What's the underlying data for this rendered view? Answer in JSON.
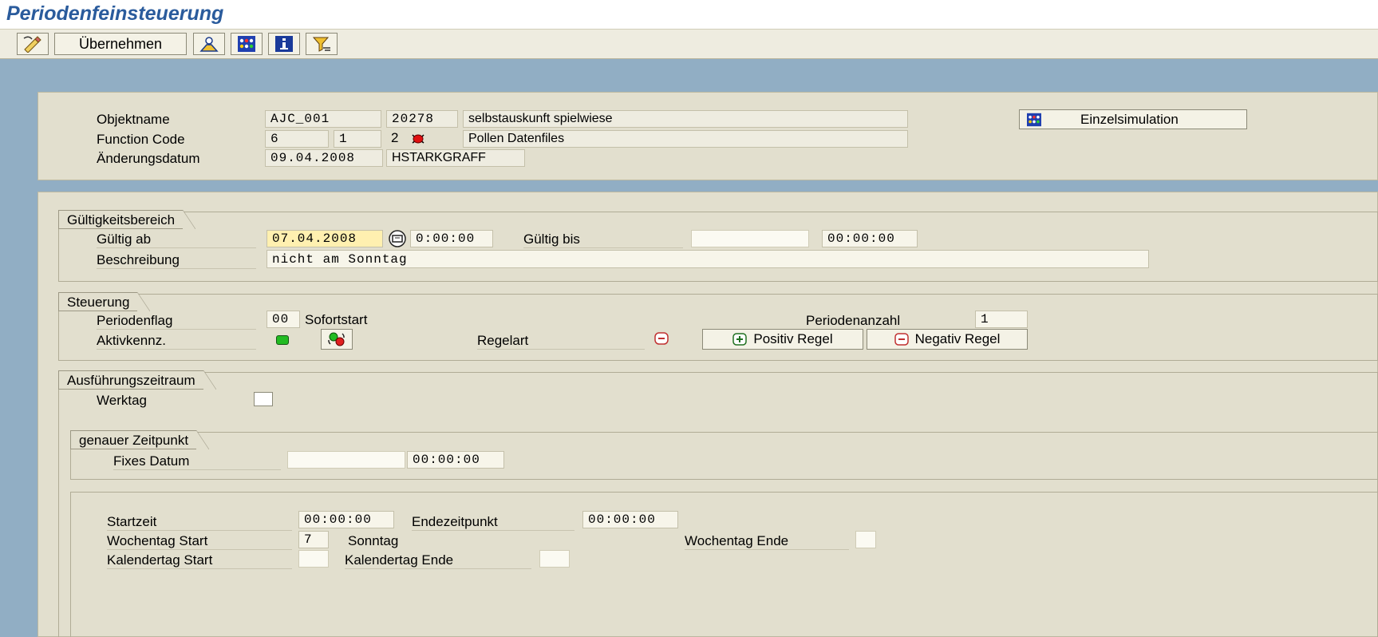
{
  "header": {
    "title": "Periodenfeinsteuerung"
  },
  "toolbar": {
    "uebernehmen": "Übernehmen"
  },
  "objekt": {
    "name_label": "Objektname",
    "name_code": "AJC_001",
    "name_num": "20278",
    "name_desc": "selbstauskunft spielwiese",
    "func_label": "Function Code",
    "func_a": "6",
    "func_b": "1",
    "func_c": "2",
    "func_desc": "Pollen Datenfiles",
    "date_label": "Änderungsdatum",
    "date_value": "09.04.2008",
    "date_user": "HSTARKGRAFF",
    "sim_button": "Einzelsimulation"
  },
  "gueltigkeit": {
    "title": "Gültigkeitsbereich",
    "ab_label": "Gültig ab",
    "ab_date": "07.04.2008",
    "ab_time": "0:00:00",
    "bis_label": "Gültig bis",
    "bis_date": "",
    "bis_time": "00:00:00",
    "beschr_label": "Beschreibung",
    "beschr_value": "nicht am Sonntag"
  },
  "steuerung": {
    "title": "Steuerung",
    "flag_label": "Periodenflag",
    "flag_code": "00",
    "flag_text": "Sofortstart",
    "anzahl_label": "Periodenanzahl",
    "anzahl_value": "1",
    "aktiv_label": "Aktivkennz.",
    "regelart_label": "Regelart",
    "positiv_button": "Positiv Regel",
    "negativ_button": "Negativ Regel",
    "status_color": "#22bb22"
  },
  "ausfuehrung": {
    "title": "Ausführungszeitraum",
    "werktag_label": "Werktag",
    "werktag_checked": false,
    "genau_title": "genauer Zeitpunkt",
    "fix_label": "Fixes Datum",
    "fix_date": "",
    "fix_time": "00:00:00"
  },
  "zeiten": {
    "start_label": "Startzeit",
    "start_value": "00:00:00",
    "ende_label": "Endezeitpunkt",
    "ende_value": "00:00:00",
    "wt_start_label": "Wochentag Start",
    "wt_start_value": "7",
    "wt_start_text": "Sonntag",
    "wt_ende_label": "Wochentag Ende",
    "wt_ende_value": "",
    "kt_start_label": "Kalendertag Start",
    "kt_start_value": "",
    "kt_ende_label": "Kalendertag Ende",
    "kt_ende_value": ""
  }
}
